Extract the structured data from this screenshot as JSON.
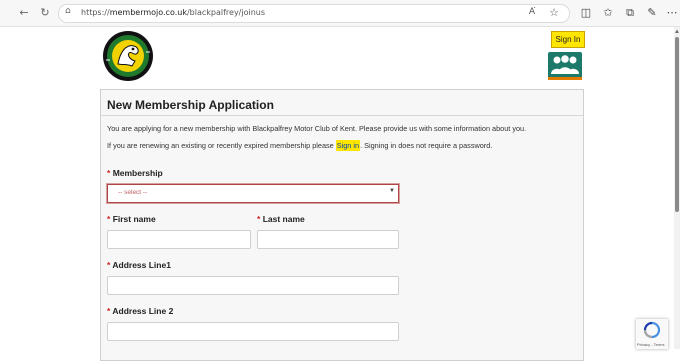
{
  "browser": {
    "url_prefix": "https://",
    "url_domain": "membermojo.co.uk",
    "url_path": "/blackpalfrey/joinus",
    "icons": [
      "back-icon",
      "refresh-icon",
      "lock-icon",
      "read-aloud-icon",
      "favorite-star-icon",
      "split-screen-icon",
      "favorites-icon",
      "collections-icon",
      "extensions-icon",
      "more-icon"
    ]
  },
  "header": {
    "signin_label": "Sign In"
  },
  "form": {
    "title": "New Membership Application",
    "intro": "You are applying for a new membership with Blackpalfrey Motor Club of Kent. Please provide us with some information about you.",
    "renew_before": "If you are renewing an existing or recently expired membership please ",
    "renew_link": "Sign in",
    "renew_after": ". Signing in does not require a password.",
    "required_marker": "*",
    "membership_label": "Membership",
    "membership_placeholder": "-- select --",
    "first_name_label": "First name",
    "last_name_label": "Last name",
    "address1_label": "Address Line1",
    "address2_label": "Address Line 2",
    "first_name_value": "",
    "last_name_value": "",
    "address1_value": "",
    "address2_value": ""
  },
  "recaptcha": {
    "footer": "Privacy - Terms"
  },
  "colors": {
    "highlight": "#ffe600",
    "required": "#d12020",
    "error_border": "#b04545",
    "logo_green": "#1f7a2e",
    "logo_yellow": "#f2d200",
    "group_icon": "#1d7a6a"
  }
}
